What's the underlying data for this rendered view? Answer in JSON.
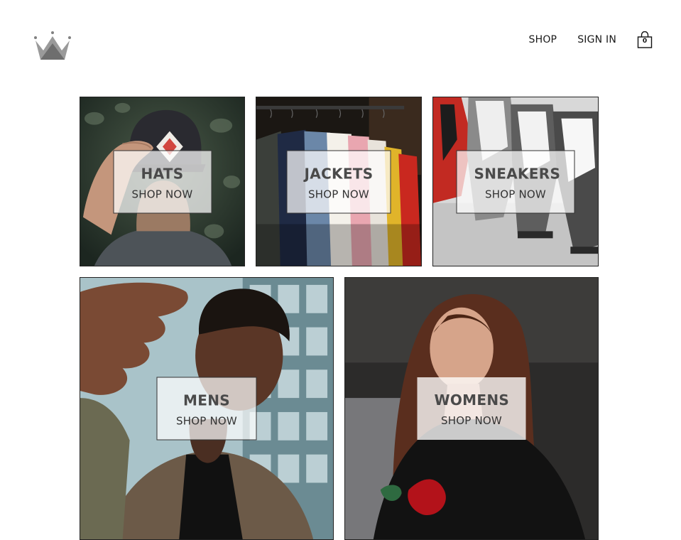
{
  "header": {
    "logo_icon": "crown-icon",
    "nav": [
      {
        "label": "SHOP"
      },
      {
        "label": "SIGN IN"
      }
    ],
    "cart": {
      "icon": "shopping-bag-icon",
      "count": "0"
    }
  },
  "directory": [
    {
      "title": "HATS",
      "subtitle": "SHOP NOW"
    },
    {
      "title": "JACKETS",
      "subtitle": "SHOP NOW"
    },
    {
      "title": "SNEAKERS",
      "subtitle": "SHOP NOW"
    },
    {
      "title": "MENS",
      "subtitle": "SHOP NOW"
    },
    {
      "title": "WOMENS",
      "subtitle": "SHOP NOW"
    }
  ],
  "colors": {
    "text": "#1a1a1a",
    "tile_border": "#222222",
    "label_title": "#4a4a4a"
  }
}
